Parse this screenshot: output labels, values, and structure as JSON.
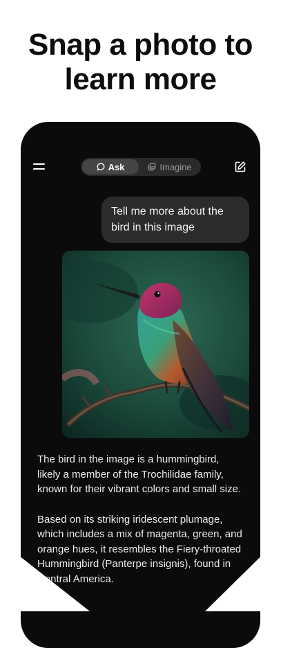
{
  "headline": {
    "line1": "Snap a photo to",
    "line2": "learn more"
  },
  "topbar": {
    "tabs": [
      {
        "label": "Ask",
        "icon": "chat-bubble-icon",
        "selected": true
      },
      {
        "label": "Imagine",
        "icon": "image-stack-icon",
        "selected": false
      }
    ],
    "menu_icon": "hamburger-menu-icon",
    "new_chat_icon": "edit-square-icon"
  },
  "conversation": {
    "user_message": "Tell me more about the bird in this image",
    "image_subject": "hummingbird",
    "reply_paragraph_1": "The bird in the image is a hummingbird, likely a member of the Trochilidae family, known for their vibrant colors and small size.",
    "reply_paragraph_2": "Based on its striking iridescent plumage, which includes a mix of magenta, green, and orange hues, it resembles the Fiery-throated Hummingbird (Panterpe insignis), found in Central America."
  },
  "colors": {
    "phone_background": "#0b0b0b",
    "bubble_background": "#2c2c2c",
    "segment_background": "#2a2a2a",
    "segment_active": "#454545"
  }
}
